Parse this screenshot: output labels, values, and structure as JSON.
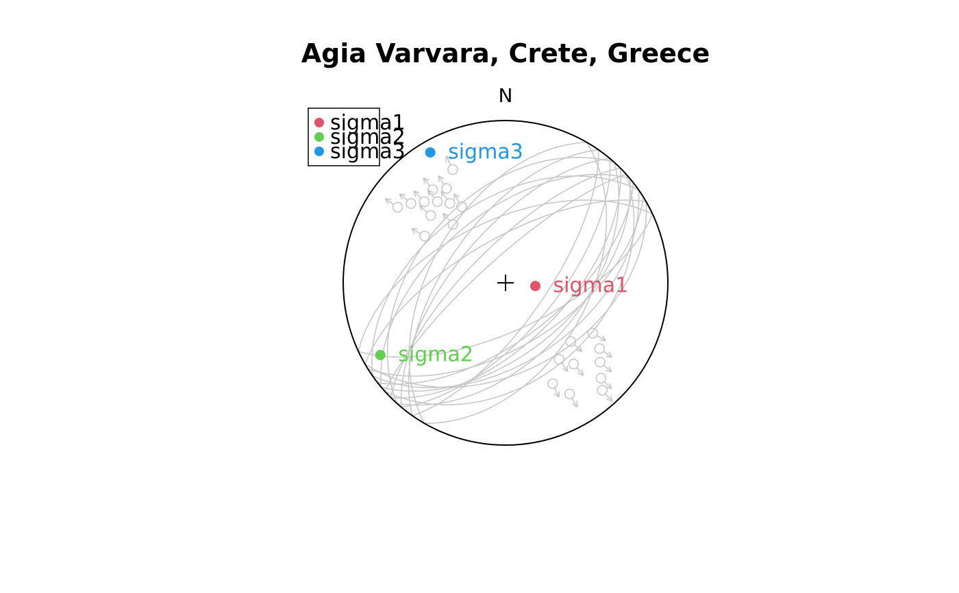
{
  "chart_data": {
    "type": "scatter",
    "projection": "stereonet (lower hemisphere)",
    "title": "Agia Varvara, Crete, Greece",
    "north_label": "N",
    "legend": {
      "placement": "top-left",
      "entries": [
        "sigma1",
        "sigma2",
        "sigma3"
      ]
    },
    "series": [
      {
        "name": "sigma1",
        "label": "sigma1",
        "color": "#DF536B",
        "azimuth": 96,
        "plunge": 75
      },
      {
        "name": "sigma2",
        "label": "sigma2",
        "color": "#61D04F",
        "azimuth": 240,
        "plunge": 12
      },
      {
        "name": "sigma3",
        "label": "sigma3",
        "color": "#2297E6",
        "azimuth": 330,
        "plunge": 8
      }
    ],
    "fault_planes": [
      {
        "dip_direction": 140,
        "dip": 55
      },
      {
        "dip_direction": 135,
        "dip": 60
      },
      {
        "dip_direction": 145,
        "dip": 50
      },
      {
        "dip_direction": 130,
        "dip": 65
      },
      {
        "dip_direction": 150,
        "dip": 45
      },
      {
        "dip_direction": 125,
        "dip": 70
      },
      {
        "dip_direction": 138,
        "dip": 40
      },
      {
        "dip_direction": 142,
        "dip": 62
      },
      {
        "dip_direction": 132,
        "dip": 52
      },
      {
        "dip_direction": 148,
        "dip": 58
      },
      {
        "dip_direction": 120,
        "dip": 48
      },
      {
        "dip_direction": 155,
        "dip": 66
      },
      {
        "dip_direction": 310,
        "dip": 65
      },
      {
        "dip_direction": 320,
        "dip": 55
      },
      {
        "dip_direction": 315,
        "dip": 72
      },
      {
        "dip_direction": 325,
        "dip": 48
      },
      {
        "dip_direction": 305,
        "dip": 60
      },
      {
        "dip_direction": 330,
        "dip": 68
      },
      {
        "dip_direction": 312,
        "dip": 45
      },
      {
        "dip_direction": 318,
        "dip": 78
      },
      {
        "dip_direction": 300,
        "dip": 52
      },
      {
        "dip_direction": 335,
        "dip": 58
      }
    ],
    "colors": {
      "planes": "#C8C8C8",
      "frame": "#000000"
    }
  }
}
